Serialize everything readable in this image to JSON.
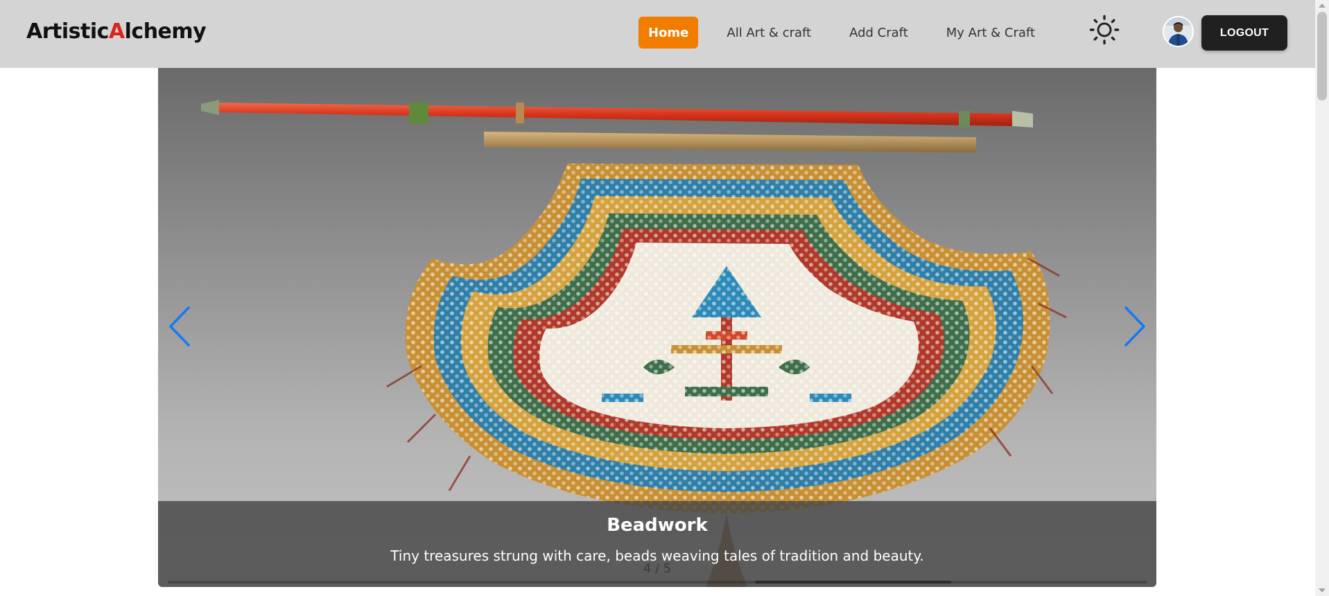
{
  "brand": {
    "prefix": "Artistic",
    "accent_letter": "A",
    "suffix": "lchemy"
  },
  "nav": {
    "links": [
      {
        "label": "Home",
        "active": true
      },
      {
        "label": "All Art & craft",
        "active": false
      },
      {
        "label": "Add Craft",
        "active": false
      },
      {
        "label": "My Art & Craft",
        "active": false
      }
    ],
    "theme_icon": "sun-icon",
    "avatar_icon": "user-avatar",
    "logout_label": "LOGOUT"
  },
  "slider": {
    "title": "Beadwork",
    "description": "Tiny treasures strung with care, beads weaving tales of tradition and beauty.",
    "pagination": "4 / 5",
    "current": 4,
    "total": 5,
    "prev_icon": "chevron-left-icon",
    "next_icon": "chevron-right-icon"
  },
  "colors": {
    "nav_bg": "#d4d4d4",
    "active_link": "#f07d00",
    "brand_accent": "#d9261c",
    "logout_bg": "#202020",
    "slider_arrow": "#1877f2"
  }
}
